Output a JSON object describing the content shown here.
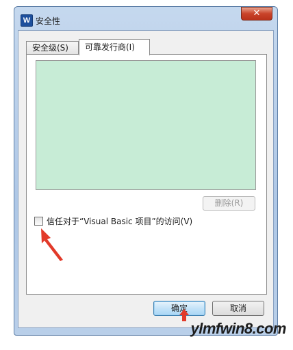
{
  "window": {
    "title": "安全性",
    "app_icon_letter": "W",
    "close_glyph": "✕"
  },
  "tabs": [
    {
      "label": "安全级(S)",
      "active": false
    },
    {
      "label": "可靠发行商(I)",
      "active": true
    }
  ],
  "publishers": {
    "list_color": "#c7ecd6",
    "items": []
  },
  "delete_button": {
    "label": "删除(R)",
    "enabled": false
  },
  "trust_vba": {
    "label": "信任对于“Visual Basic 项目”的访问(V)",
    "checked": false
  },
  "ok_button": {
    "label": "确定"
  },
  "cancel_button": {
    "label": "取消"
  },
  "annotation": {
    "arrow_color": "#e23a2a"
  },
  "watermark": {
    "text": "ylmfwin8.com"
  }
}
